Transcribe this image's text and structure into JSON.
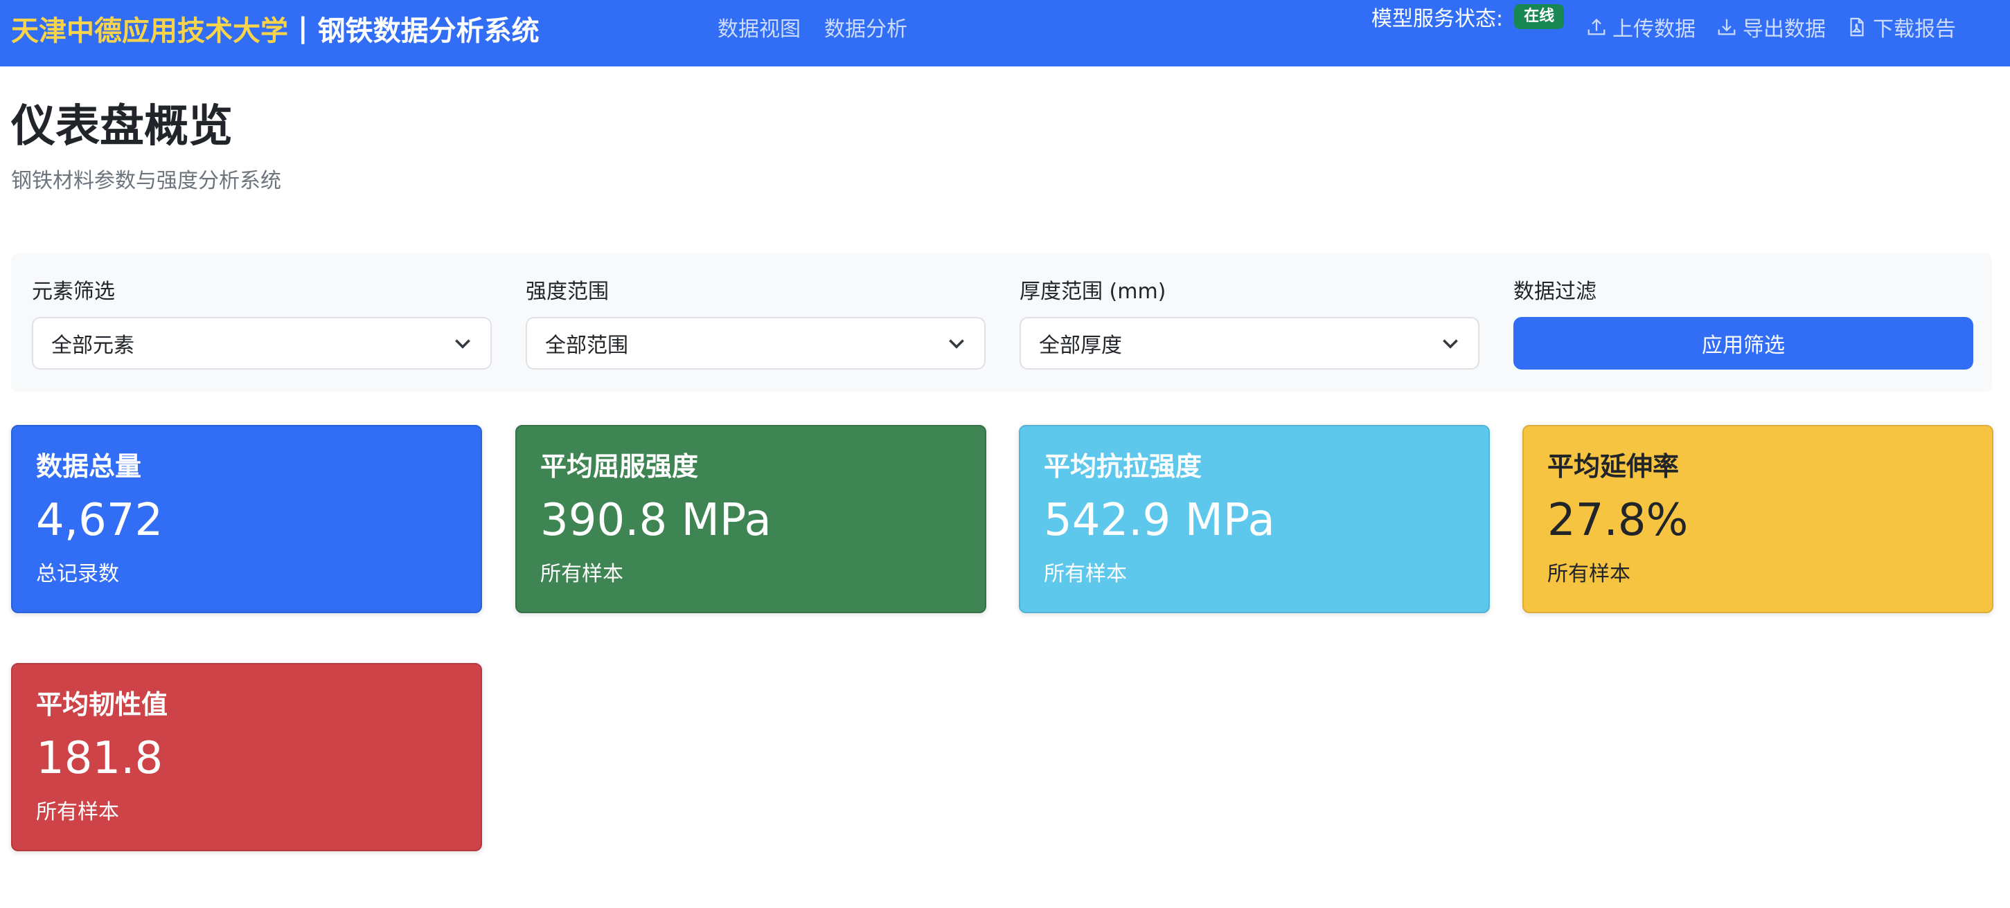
{
  "navbar": {
    "brand_school": "天津中德应用技术大学",
    "brand_separator": "|",
    "brand_system": "钢铁数据分析系统",
    "links": [
      {
        "label": "数据视图"
      },
      {
        "label": "数据分析"
      }
    ],
    "status_label": "模型服务状态:",
    "status_badge": "在线",
    "actions": [
      {
        "label": "上传数据",
        "icon": "upload-icon"
      },
      {
        "label": "导出数据",
        "icon": "download-icon"
      },
      {
        "label": "下载报告",
        "icon": "pdf-file-icon"
      }
    ]
  },
  "header": {
    "title": "仪表盘概览",
    "subtitle": "钢铁材料参数与强度分析系统"
  },
  "filters": {
    "element": {
      "label": "元素筛选",
      "value": "全部元素"
    },
    "strength": {
      "label": "强度范围",
      "value": "全部范围"
    },
    "thickness": {
      "label": "厚度范围 (mm)",
      "value": "全部厚度"
    },
    "data_filter": {
      "label": "数据过滤",
      "button": "应用筛选"
    }
  },
  "stats": [
    {
      "title": "数据总量",
      "value": "4,672",
      "note": "总记录数",
      "color": "#316ef5"
    },
    {
      "title": "平均屈服强度",
      "value": "390.8 MPa",
      "note": "所有样本",
      "color": "#3f8553"
    },
    {
      "title": "平均抗拉强度",
      "value": "542.9 MPa",
      "note": "所有样本",
      "color": "#5ec8ec"
    },
    {
      "title": "平均延伸率",
      "value": "27.8%",
      "note": "所有样本",
      "color": "#f6c440"
    },
    {
      "title": "平均韧性值",
      "value": "181.8",
      "note": "所有样本",
      "color": "#cd4348"
    }
  ],
  "colors": {
    "primary": "#316ef5",
    "brand_accent": "#f9d349",
    "success": "#198754"
  }
}
